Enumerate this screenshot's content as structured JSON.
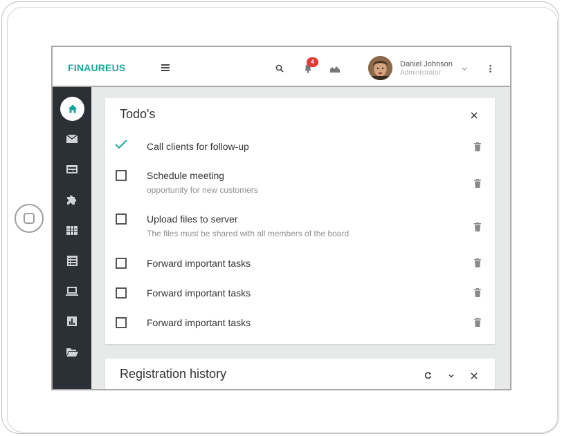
{
  "header": {
    "brand": "FINAUREUS",
    "notification_count": "4",
    "user_name": "Daniel Johnson",
    "user_role": "Administrator"
  },
  "sidebar": {
    "items": [
      {
        "icon": "home-icon",
        "active": true
      },
      {
        "icon": "mail-icon"
      },
      {
        "icon": "card-icon"
      },
      {
        "icon": "puzzle-icon"
      },
      {
        "icon": "table-icon"
      },
      {
        "icon": "list-icon"
      },
      {
        "icon": "laptop-icon"
      },
      {
        "icon": "bar-chart-icon"
      },
      {
        "icon": "folder-icon"
      }
    ]
  },
  "todo": {
    "title": "Todo's",
    "items": [
      {
        "title": "Call clients for follow-up",
        "subtitle": "",
        "done": true
      },
      {
        "title": "Schedule meeting",
        "subtitle": "opportunity for new customers",
        "done": false
      },
      {
        "title": "Upload files to server",
        "subtitle": "The files must be shared with all members of the board",
        "done": false
      },
      {
        "title": "Forward important tasks",
        "subtitle": "",
        "done": false
      },
      {
        "title": "Forward important tasks",
        "subtitle": "",
        "done": false
      },
      {
        "title": "Forward important tasks",
        "subtitle": "",
        "done": false
      }
    ]
  },
  "registration": {
    "title": "Registration history"
  },
  "colors": {
    "brand": "#1aa59b",
    "sidebar": "#2b3036",
    "badge": "#e53935"
  }
}
